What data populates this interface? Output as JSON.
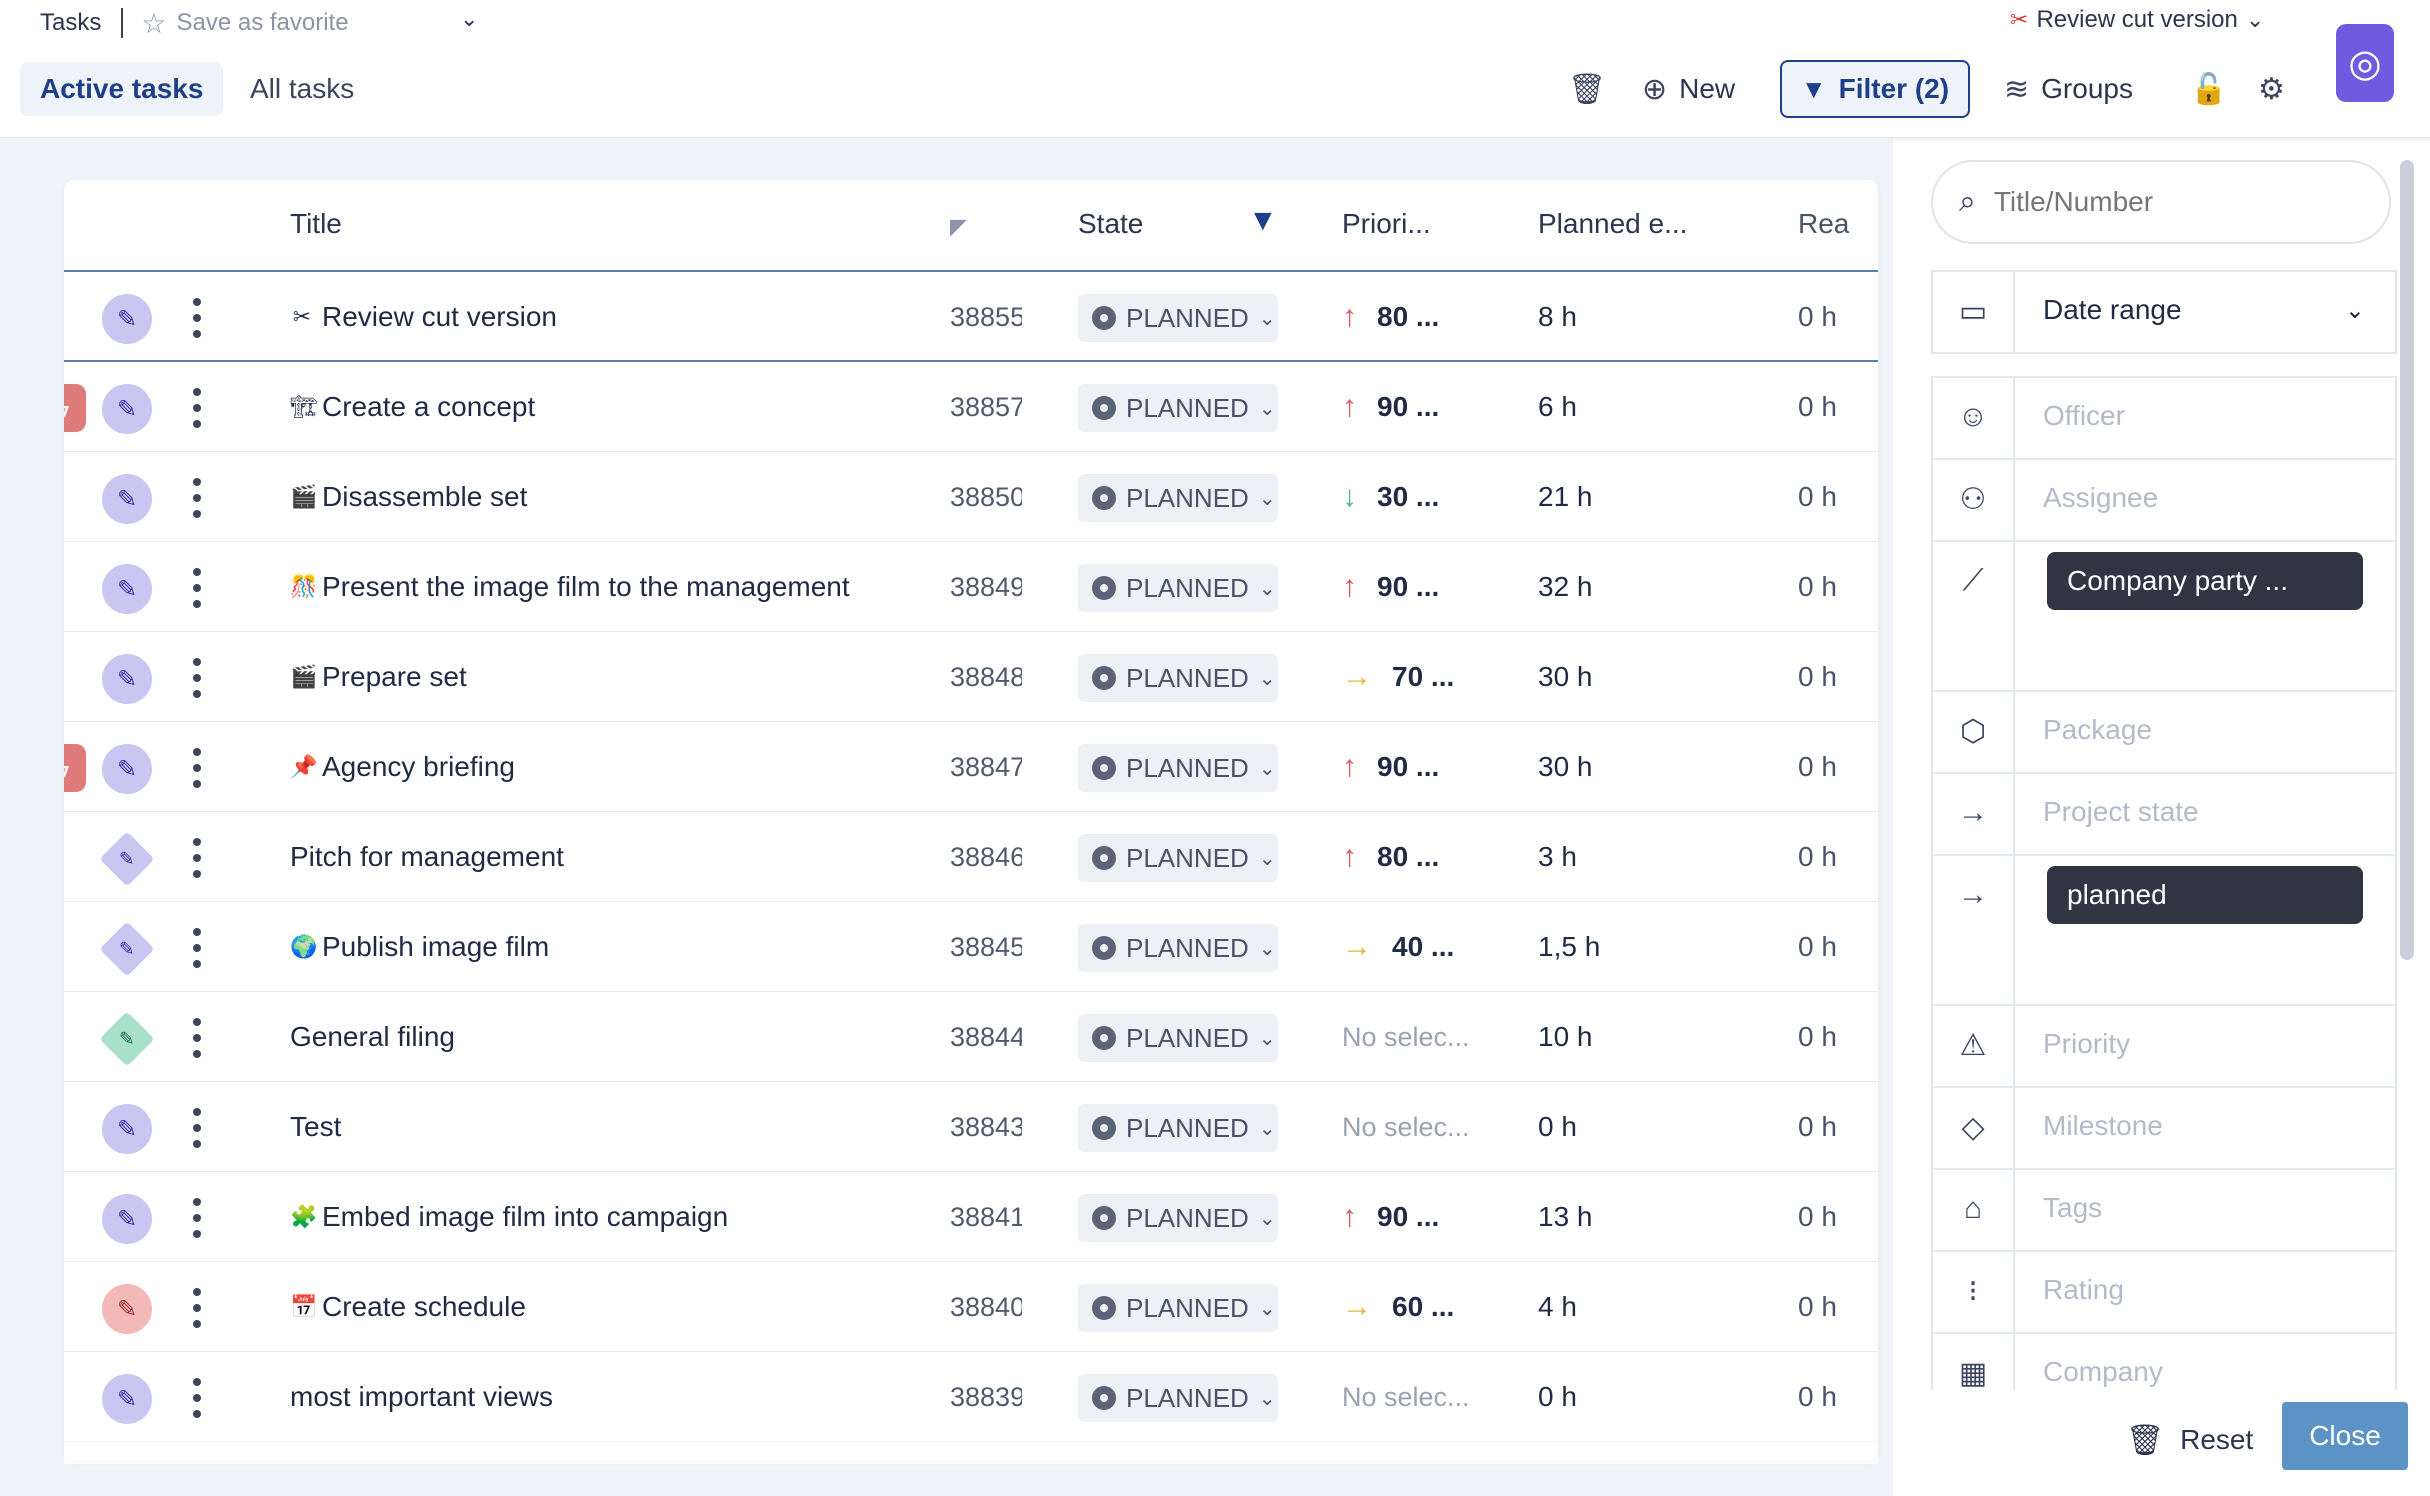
{
  "header": {
    "breadcrumb": "Tasks",
    "favorite_label": "Save as favorite",
    "current_task": "Review cut version",
    "tabs": [
      {
        "label": "Active tasks",
        "active": true
      },
      {
        "label": "All tasks",
        "active": false
      }
    ],
    "toolbar": {
      "new_label": "New",
      "filter_label": "Filter (2)",
      "groups_label": "Groups"
    }
  },
  "table": {
    "columns": [
      "Title",
      "State",
      "Priori...",
      "Planned e...",
      "Rea"
    ],
    "rows": [
      {
        "title": "Review cut version",
        "emoji": "✂",
        "number": "38855",
        "state": "PLANNED",
        "prio_dir": "up",
        "priority": "80 ...",
        "planned": "8 h",
        "real": "0 h",
        "urgent": false,
        "edit": "circle"
      },
      {
        "title": "Create a concept",
        "emoji": "🏗",
        "number": "38857",
        "state": "PLANNED",
        "prio_dir": "up",
        "priority": "90 ...",
        "planned": "6 h",
        "real": "0 h",
        "urgent": true,
        "edit": "circle"
      },
      {
        "title": "Disassemble set",
        "emoji": "🎬",
        "number": "38850",
        "state": "PLANNED",
        "prio_dir": "down",
        "priority": "30 ...",
        "planned": "21 h",
        "real": "0 h",
        "urgent": false,
        "edit": "circle"
      },
      {
        "title": "Present the image film to the management",
        "emoji": "🎊",
        "number": "38849",
        "state": "PLANNED",
        "prio_dir": "up",
        "priority": "90 ...",
        "planned": "32 h",
        "real": "0 h",
        "urgent": false,
        "edit": "circle"
      },
      {
        "title": "Prepare set",
        "emoji": "🎬",
        "number": "38848",
        "state": "PLANNED",
        "prio_dir": "right",
        "priority": "70 ...",
        "planned": "30 h",
        "real": "0 h",
        "urgent": false,
        "edit": "circle"
      },
      {
        "title": "Agency briefing",
        "emoji": "📌",
        "number": "38847",
        "state": "PLANNED",
        "prio_dir": "up",
        "priority": "90 ...",
        "planned": "30 h",
        "real": "0 h",
        "urgent": true,
        "edit": "circle"
      },
      {
        "title": "Pitch for management",
        "emoji": "",
        "number": "38846",
        "state": "PLANNED",
        "prio_dir": "up",
        "priority": "80 ...",
        "planned": "3 h",
        "real": "0 h",
        "urgent": false,
        "edit": "diamond"
      },
      {
        "title": "Publish image film",
        "emoji": "🌍",
        "number": "38845",
        "state": "PLANNED",
        "prio_dir": "right",
        "priority": "40 ...",
        "planned": "1,5 h",
        "real": "0 h",
        "urgent": false,
        "edit": "diamond"
      },
      {
        "title": "General filing",
        "emoji": "",
        "number": "38844",
        "state": "PLANNED",
        "prio_dir": "none",
        "priority": "No selec...",
        "planned": "10 h",
        "real": "0 h",
        "urgent": false,
        "edit": "diamond-green"
      },
      {
        "title": "Test",
        "emoji": "",
        "number": "38843",
        "state": "PLANNED",
        "prio_dir": "none",
        "priority": "No selec...",
        "planned": "0 h",
        "real": "0 h",
        "urgent": false,
        "edit": "circle"
      },
      {
        "title": "Embed image film into campaign",
        "emoji": "🧩",
        "number": "38841",
        "state": "PLANNED",
        "prio_dir": "up",
        "priority": "90 ...",
        "planned": "13 h",
        "real": "0 h",
        "urgent": false,
        "edit": "circle"
      },
      {
        "title": "Create schedule",
        "emoji": "📅",
        "number": "38840",
        "state": "PLANNED",
        "prio_dir": "right",
        "priority": "60 ...",
        "planned": "4 h",
        "real": "0 h",
        "urgent": false,
        "edit": "circle-red"
      },
      {
        "title": "most important views",
        "emoji": "",
        "number": "38839",
        "state": "PLANNED",
        "prio_dir": "none",
        "priority": "No selec...",
        "planned": "0 h",
        "real": "0 h",
        "urgent": false,
        "edit": "circle"
      }
    ]
  },
  "filter_panel": {
    "search_placeholder": "Title/Number",
    "date_range_label": "Date range",
    "fields": {
      "officer": "Officer",
      "assignee": "Assignee",
      "project_chip": "Company party ...",
      "package": "Package",
      "project_state": "Project state",
      "state_chip": "planned",
      "priority": "Priority",
      "milestone": "Milestone",
      "tags": "Tags",
      "rating": "Rating",
      "company": "Company"
    },
    "reset_label": "Reset",
    "close_label": "Close"
  },
  "colors": {
    "accent": "#1e3f8a",
    "prio_up": "#d8585d",
    "prio_down": "#4ab892",
    "prio_right": "#e7b43a",
    "close_button": "#5b93c7",
    "chip": "#2f3542"
  }
}
